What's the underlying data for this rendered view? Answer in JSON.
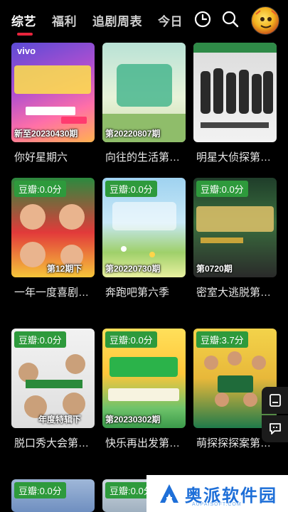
{
  "tabs": [
    "综艺",
    "福利",
    "追剧周表",
    "今日"
  ],
  "icons": {
    "history": "clock-icon",
    "search": "search-icon",
    "avatar": "avatar"
  },
  "cards": [
    {
      "title": "你好星期六",
      "episode": "新至20230430期",
      "badge": ""
    },
    {
      "title": "向往的生活第…",
      "episode": "第20220807期",
      "badge": ""
    },
    {
      "title": "明星大侦探第…",
      "episode": "",
      "badge": ""
    },
    {
      "title": "一年一度喜剧…",
      "episode": "第12期下",
      "badge": "豆瓣:0.0分"
    },
    {
      "title": "奔跑吧第六季",
      "episode": "第20220730期",
      "badge": "豆瓣:0.0分"
    },
    {
      "title": "密室大逃脱第…",
      "episode": "第0720期",
      "badge": "豆瓣:0.0分"
    },
    {
      "title": "脱口秀大会第…",
      "episode": "年度特辑下",
      "badge": "豆瓣:0.0分"
    },
    {
      "title": "快乐再出发第…",
      "episode": "第20230302期",
      "badge": "豆瓣:0.0分"
    },
    {
      "title": "萌探探探案第…",
      "episode": "",
      "badge": "豆瓣:3.7分"
    },
    {
      "title": "",
      "episode": "",
      "badge": "豆瓣:0.0分"
    },
    {
      "title": "",
      "episode": "",
      "badge": "豆瓣:0.0分"
    }
  ],
  "watermark": {
    "text": "奥派软件园",
    "sub": "AUPAISOFT.COM"
  },
  "colors": {
    "accent": "#e8243c",
    "badge": "#2e9a3c",
    "watermark": "#1e6fd8"
  }
}
